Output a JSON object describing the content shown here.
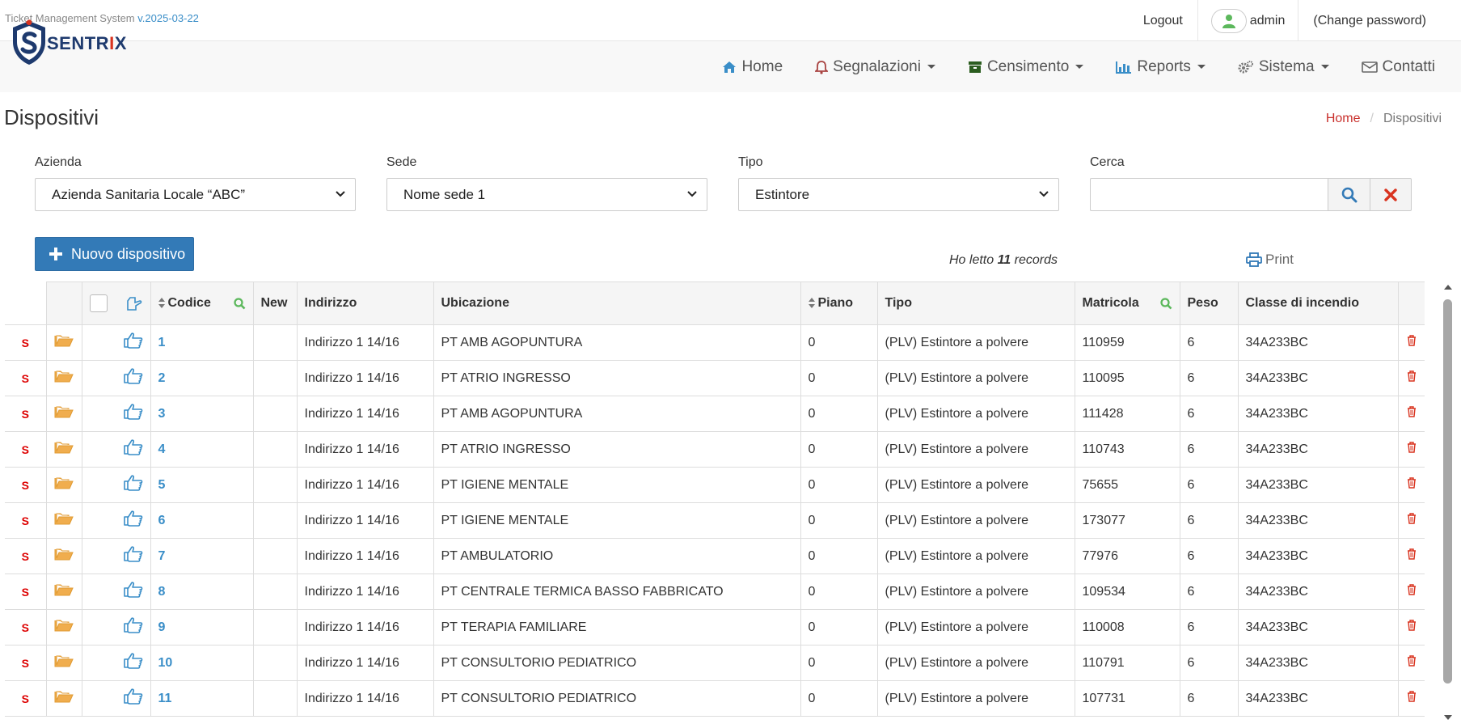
{
  "app": {
    "title": "Ticket Management System",
    "version": "v.2025-03-22"
  },
  "top": {
    "logout": "Logout",
    "user": "admin",
    "change_password": "(Change password)"
  },
  "logo": {
    "brand_left": "SENTR",
    "brand_i": "I",
    "brand_x": "X"
  },
  "nav": {
    "home": "Home",
    "segnalazioni": "Segnalazioni",
    "censimento": "Censimento",
    "reports": "Reports",
    "sistema": "Sistema",
    "contatti": "Contatti"
  },
  "page": {
    "title": "Dispositivi"
  },
  "breadcrumb": {
    "home": "Home",
    "current": "Dispositivi"
  },
  "filters": {
    "azienda": {
      "label": "Azienda",
      "value": "Azienda Sanitaria Locale “ABC”"
    },
    "sede": {
      "label": "Sede",
      "value": "Nome sede 1"
    },
    "tipo": {
      "label": "Tipo",
      "value": "Estintore"
    },
    "cerca": {
      "label": "Cerca",
      "value": ""
    }
  },
  "actions": {
    "new_device": "Nuovo dispositivo",
    "print": "Print"
  },
  "records": {
    "prefix": "Ho letto",
    "count": "11",
    "suffix": "records"
  },
  "table": {
    "headers": {
      "codice": "Codice",
      "new": "New",
      "indirizzo": "Indirizzo",
      "ubicazione": "Ubicazione",
      "piano": "Piano",
      "tipo": "Tipo",
      "matricola": "Matricola",
      "peso": "Peso",
      "classe": "Classe di incendio"
    },
    "rows": [
      {
        "s": "S",
        "codice": "1",
        "new": "",
        "indirizzo": "Indirizzo 1 14/16",
        "ubicazione": "PT AMB AGOPUNTURA",
        "piano": "0",
        "tipo": "(PLV) Estintore a polvere",
        "matricola": "110959",
        "peso": "6",
        "classe": "34A233BC"
      },
      {
        "s": "S",
        "codice": "2",
        "new": "",
        "indirizzo": "Indirizzo 1 14/16",
        "ubicazione": "PT ATRIO INGRESSO",
        "piano": "0",
        "tipo": "(PLV) Estintore a polvere",
        "matricola": "110095",
        "peso": "6",
        "classe": "34A233BC"
      },
      {
        "s": "S",
        "codice": "3",
        "new": "",
        "indirizzo": "Indirizzo 1 14/16",
        "ubicazione": "PT AMB AGOPUNTURA",
        "piano": "0",
        "tipo": "(PLV) Estintore a polvere",
        "matricola": "111428",
        "peso": "6",
        "classe": "34A233BC"
      },
      {
        "s": "S",
        "codice": "4",
        "new": "",
        "indirizzo": "Indirizzo 1 14/16",
        "ubicazione": "PT ATRIO INGRESSO",
        "piano": "0",
        "tipo": "(PLV) Estintore a polvere",
        "matricola": "110743",
        "peso": "6",
        "classe": "34A233BC"
      },
      {
        "s": "S",
        "codice": "5",
        "new": "",
        "indirizzo": "Indirizzo 1 14/16",
        "ubicazione": "PT IGIENE MENTALE",
        "piano": "0",
        "tipo": "(PLV) Estintore a polvere",
        "matricola": "75655",
        "peso": "6",
        "classe": "34A233BC"
      },
      {
        "s": "S",
        "codice": "6",
        "new": "",
        "indirizzo": "Indirizzo 1 14/16",
        "ubicazione": "PT IGIENE MENTALE",
        "piano": "0",
        "tipo": "(PLV) Estintore a polvere",
        "matricola": "173077",
        "peso": "6",
        "classe": "34A233BC"
      },
      {
        "s": "S",
        "codice": "7",
        "new": "",
        "indirizzo": "Indirizzo 1 14/16",
        "ubicazione": "PT AMBULATORIO",
        "piano": "0",
        "tipo": "(PLV) Estintore a polvere",
        "matricola": "77976",
        "peso": "6",
        "classe": "34A233BC"
      },
      {
        "s": "S",
        "codice": "8",
        "new": "",
        "indirizzo": "Indirizzo 1 14/16",
        "ubicazione": "PT CENTRALE TERMICA BASSO FABBRICATO",
        "piano": "0",
        "tipo": "(PLV) Estintore a polvere",
        "matricola": "109534",
        "peso": "6",
        "classe": "34A233BC"
      },
      {
        "s": "S",
        "codice": "9",
        "new": "",
        "indirizzo": "Indirizzo 1 14/16",
        "ubicazione": "PT TERAPIA FAMILIARE",
        "piano": "0",
        "tipo": "(PLV) Estintore a polvere",
        "matricola": "110008",
        "peso": "6",
        "classe": "34A233BC"
      },
      {
        "s": "S",
        "codice": "10",
        "new": "",
        "indirizzo": "Indirizzo 1 14/16",
        "ubicazione": "PT CONSULTORIO PEDIATRICO",
        "piano": "0",
        "tipo": "(PLV) Estintore a polvere",
        "matricola": "110791",
        "peso": "6",
        "classe": "34A233BC"
      },
      {
        "s": "S",
        "codice": "11",
        "new": "",
        "indirizzo": "Indirizzo 1 14/16",
        "ubicazione": "PT CONSULTORIO PEDIATRICO",
        "piano": "0",
        "tipo": "(PLV) Estintore a polvere",
        "matricola": "107731",
        "peso": "6",
        "classe": "34A233BC"
      }
    ]
  },
  "icons": {
    "folder": "folder-open-icon",
    "hand": "hand-pointer-icon",
    "trash": "trash-icon",
    "search": "search-icon",
    "clear": "times-icon",
    "print": "print-icon",
    "plus": "plus-icon"
  },
  "colors": {
    "primary": "#337ab7",
    "link": "#3a8ec8",
    "danger": "#d9331f",
    "folder": "#f0ad4e",
    "green": "#5cb85c"
  }
}
